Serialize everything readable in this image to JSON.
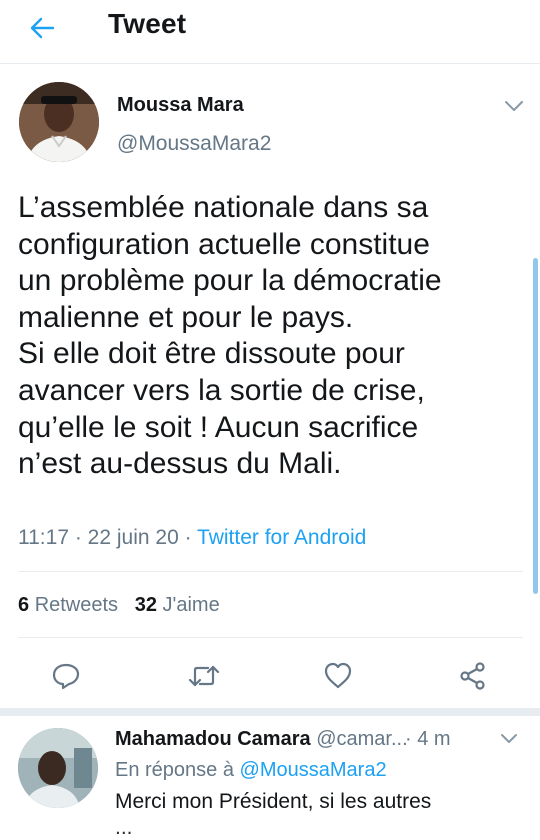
{
  "header": {
    "title": "Tweet",
    "back_icon": "arrow-left-icon",
    "accent": "#1da1f2"
  },
  "tweet": {
    "author_name": "Moussa Mara",
    "author_handle": "@MoussaMara2",
    "text": "L’assemblée nationale dans sa\nconfiguration actuelle constitue\nun problème pour la démocratie\nmalienne et pour le pays.\nSi elle doit être dissoute pour\navancer vers la sortie de crise,\nqu’elle le soit ! Aucun sacrifice\nn’est au-dessus du Mali.",
    "time": "11:17",
    "separator": " · ",
    "date": "22 juin 20",
    "source": "Twitter for Android",
    "retweets_count": "6",
    "retweets_label": "Retweets",
    "likes_count": "32",
    "likes_label": "J'aime"
  },
  "actions": [
    {
      "icon": "reply-icon"
    },
    {
      "icon": "retweet-icon"
    },
    {
      "icon": "heart-icon"
    },
    {
      "icon": "share-icon"
    }
  ],
  "reply": {
    "author_name": "Mahamadou Camara",
    "author_handle": "@camar...",
    "time": "· 4 m",
    "in_reply_to_label": "En réponse à",
    "in_reply_to_handle": "@MoussaMara2",
    "text_line_1": "Merci mon Président,  si les autres",
    "text_line_2": "..."
  },
  "colors": {
    "text": "#14171a",
    "secondary": "#657786",
    "link": "#1da1f2",
    "divider": "#e6ecf0"
  }
}
